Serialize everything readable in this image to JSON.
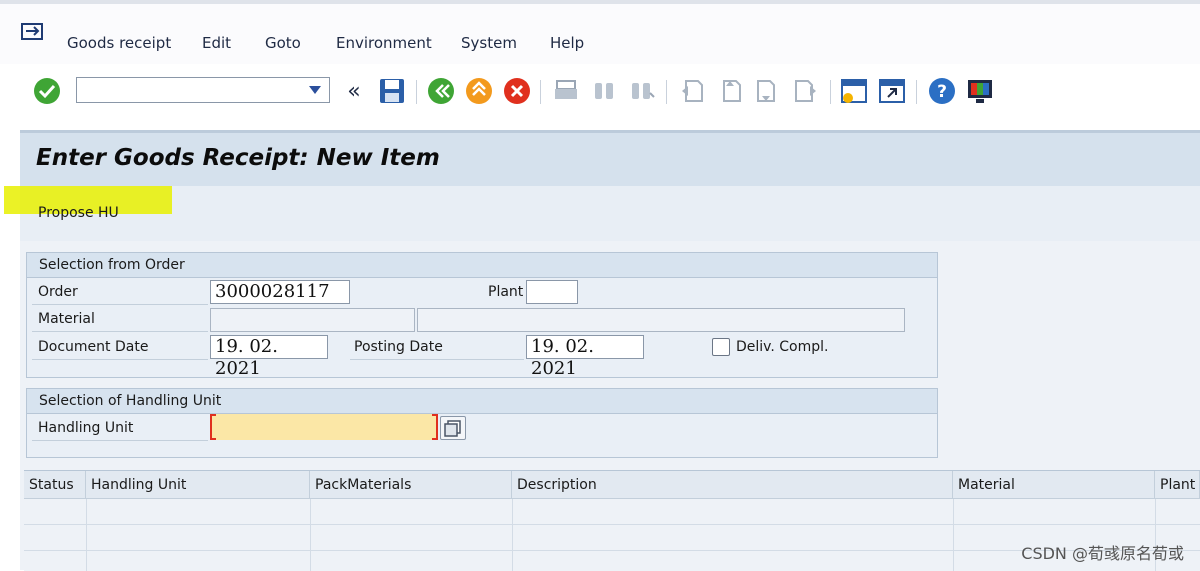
{
  "menu": [
    "Goods receipt",
    "Edit",
    "Goto",
    "Environment",
    "System",
    "Help"
  ],
  "toolbar": {
    "command_field_value": "",
    "icons": [
      "enter-icon",
      "dropdown-icon",
      "double-chevron-left-icon",
      "save-icon",
      "back-icon",
      "exit-icon",
      "cancel-icon",
      "print-icon",
      "find-icon",
      "find-next-icon",
      "first-page-icon",
      "previous-page-icon",
      "next-page-icon",
      "last-page-icon",
      "create-session-icon",
      "generate-shortcut-icon",
      "help-icon",
      "customize-layout-icon"
    ]
  },
  "title": "Enter Goods Receipt: New Item",
  "app_toolbar": {
    "propose_hu": "Propose HU"
  },
  "selection_order": {
    "header": "Selection from Order",
    "order_label": "Order",
    "order_value": "3000028117",
    "plant_label": "Plant",
    "plant_value": "",
    "material_label": "Material",
    "material_value": "",
    "material_desc": "",
    "doc_date_label": "Document Date",
    "doc_date_value": "19. 02. 2021",
    "posting_date_label": "Posting Date",
    "posting_date_value": "19. 02. 2021",
    "deliv_compl_label": "Deliv. Compl.",
    "deliv_compl_checked": false
  },
  "selection_hu": {
    "header": "Selection of Handling Unit",
    "hu_label": "Handling Unit",
    "hu_value": ""
  },
  "table": {
    "columns": [
      "Status",
      "Handling Unit",
      "PackMaterials",
      "Description",
      "Material",
      "Plant"
    ],
    "rows": []
  },
  "watermark": "CSDN @荀彧原名荀或",
  "colors": {
    "accent_green": "#3fa535",
    "accent_orange": "#f39a1d",
    "accent_red": "#e0301e",
    "title_band": "#d5e1ed",
    "required_field": "#fbe7a6"
  }
}
